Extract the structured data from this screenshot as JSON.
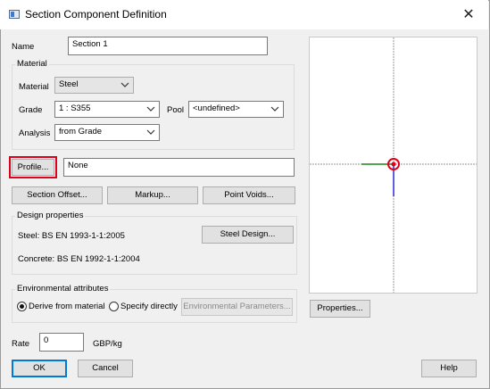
{
  "window": {
    "title": "Section Component Definition",
    "close_glyph": "✕"
  },
  "name": {
    "label": "Name",
    "value": "Section 1"
  },
  "material_group": {
    "title": "Material",
    "material_label": "Material",
    "material_value": "Steel",
    "grade_label": "Grade",
    "grade_value": "1 : S355",
    "pool_label": "Pool",
    "pool_value": "<undefined>",
    "analysis_label": "Analysis",
    "analysis_value": "from Grade"
  },
  "profile": {
    "button_label": "Profile...",
    "value": "None"
  },
  "buttons": {
    "section_offset": "Section Offset...",
    "markup": "Markup...",
    "point_voids": "Point Voids...",
    "steel_design": "Steel Design...",
    "properties": "Properties...",
    "env_parameters": "Environmental Parameters...",
    "ok": "OK",
    "cancel": "Cancel",
    "help": "Help"
  },
  "design_group": {
    "title": "Design properties",
    "steel_text": "Steel: BS EN 1993-1-1:2005",
    "concrete_text": "Concrete: BS EN 1992-1-1:2004"
  },
  "env_group": {
    "title": "Environmental attributes",
    "derive_label": "Derive from material",
    "specify_label": "Specify directly",
    "selected": "derive"
  },
  "rate": {
    "label": "Rate",
    "value": "0",
    "unit": "GBP/kg"
  },
  "colors": {
    "highlight": "#e0001b",
    "axis_y": "#1a1ad8",
    "axis_x": "#1a8a1a",
    "origin": "#e0001b"
  }
}
